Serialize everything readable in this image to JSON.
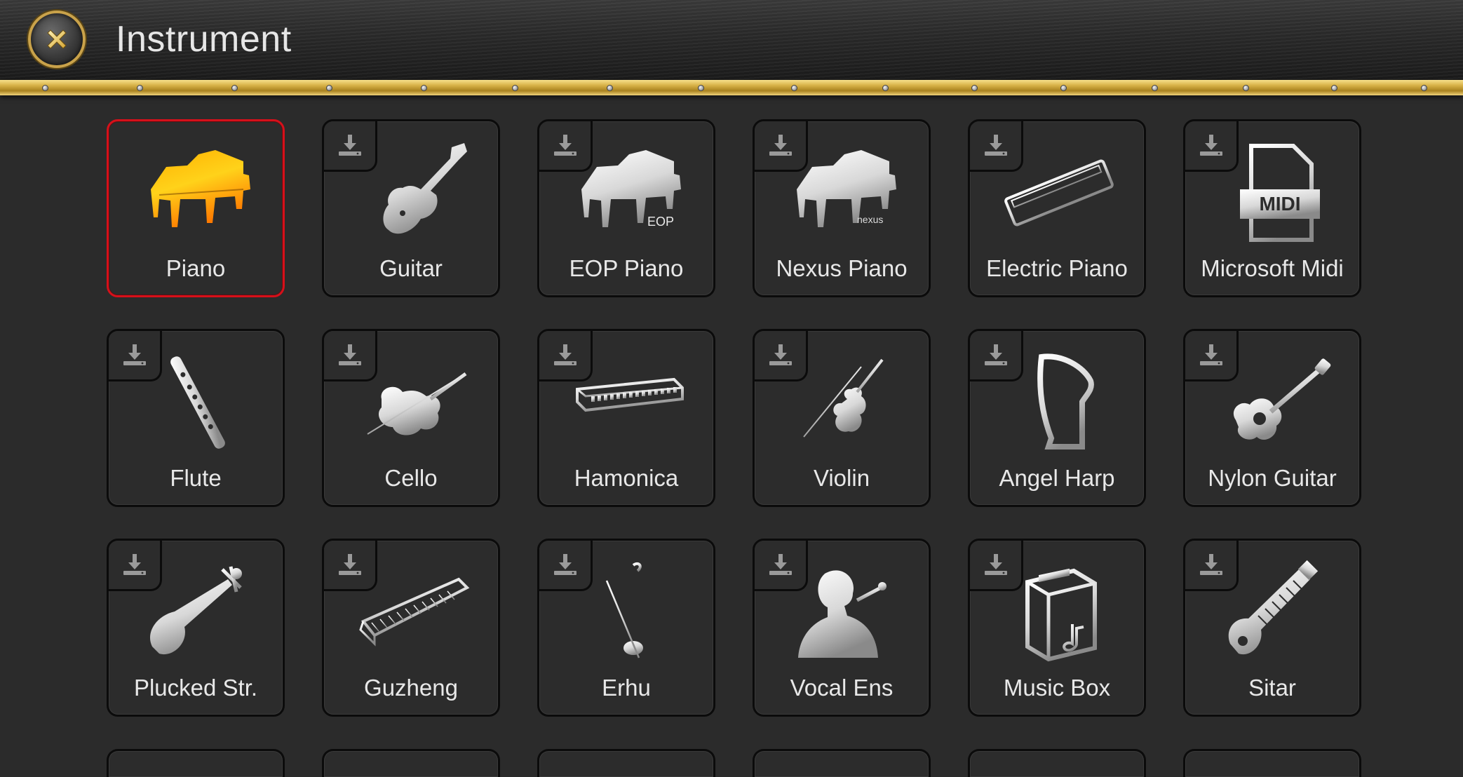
{
  "header": {
    "title": "Instrument",
    "close_icon": "close-x-icon"
  },
  "colors": {
    "selected_border": "#d6101a",
    "gold_accent": "#c9a24a",
    "tile_bg": "#2c2c2c",
    "page_bg": "#2b2b2b"
  },
  "instruments": [
    {
      "label": "Piano",
      "icon": "grand-piano-icon",
      "selected": true,
      "downloadable": false
    },
    {
      "label": "Guitar",
      "icon": "electric-guitar-icon",
      "selected": false,
      "downloadable": true
    },
    {
      "label": "EOP Piano",
      "icon": "eop-piano-icon",
      "icon_text": "EOP",
      "selected": false,
      "downloadable": true
    },
    {
      "label": "Nexus Piano",
      "icon": "nexus-piano-icon",
      "icon_text": "nexus",
      "selected": false,
      "downloadable": true
    },
    {
      "label": "Electric Piano",
      "icon": "keyboard-synth-icon",
      "selected": false,
      "downloadable": true
    },
    {
      "label": "Microsoft Midi",
      "icon": "midi-file-icon",
      "icon_text": "MIDI",
      "selected": false,
      "downloadable": true
    },
    {
      "label": "Flute",
      "icon": "flute-icon",
      "selected": false,
      "downloadable": true
    },
    {
      "label": "Cello",
      "icon": "cello-icon",
      "selected": false,
      "downloadable": true
    },
    {
      "label": "Hamonica",
      "icon": "harmonica-icon",
      "selected": false,
      "downloadable": true
    },
    {
      "label": "Violin",
      "icon": "violin-icon",
      "selected": false,
      "downloadable": true
    },
    {
      "label": "Angel Harp",
      "icon": "harp-icon",
      "selected": false,
      "downloadable": true
    },
    {
      "label": "Nylon Guitar",
      "icon": "acoustic-guitar-icon",
      "selected": false,
      "downloadable": true
    },
    {
      "label": "Plucked Str.",
      "icon": "pipa-icon",
      "selected": false,
      "downloadable": true
    },
    {
      "label": "Guzheng",
      "icon": "guzheng-icon",
      "selected": false,
      "downloadable": true
    },
    {
      "label": "Erhu",
      "icon": "erhu-icon",
      "selected": false,
      "downloadable": true
    },
    {
      "label": "Vocal Ens",
      "icon": "singer-icon",
      "selected": false,
      "downloadable": true
    },
    {
      "label": "Music Box",
      "icon": "music-box-icon",
      "selected": false,
      "downloadable": true
    },
    {
      "label": "Sitar",
      "icon": "sitar-icon",
      "selected": false,
      "downloadable": true
    }
  ],
  "download_icon": "download-icon"
}
